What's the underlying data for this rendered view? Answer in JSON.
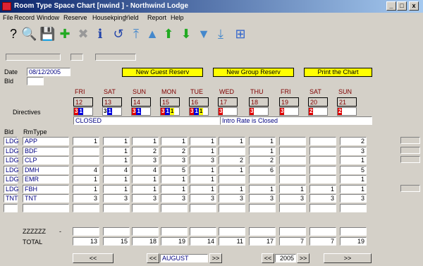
{
  "window": {
    "title": "Room Type Space Chart [nwind  ] - Northwind Lodge",
    "min": "_",
    "max": "□",
    "close": "x"
  },
  "menu": [
    "File",
    "Record",
    "Window",
    "Reserve",
    "Housekping",
    "Yield",
    "Report",
    "Help"
  ],
  "toolbar": [
    {
      "name": "help-icon",
      "glyph": "?",
      "color": "#000"
    },
    {
      "name": "search-icon",
      "glyph": "🔍",
      "color": "#666"
    },
    {
      "name": "save-icon",
      "glyph": "💾",
      "color": "#0a4"
    },
    {
      "name": "add-icon",
      "glyph": "✚",
      "color": "#2a2"
    },
    {
      "name": "delete-icon",
      "glyph": "✖",
      "color": "#999"
    },
    {
      "name": "info-icon",
      "glyph": "ℹ",
      "color": "#24a"
    },
    {
      "name": "undo-icon",
      "glyph": "↺",
      "color": "#24a"
    },
    {
      "name": "first-record-icon",
      "glyph": "⤒",
      "color": "#48c"
    },
    {
      "name": "prev-record-icon",
      "glyph": "▲",
      "color": "#48c"
    },
    {
      "name": "up-icon",
      "glyph": "⬆",
      "color": "#2a2"
    },
    {
      "name": "down-icon",
      "glyph": "⬇",
      "color": "#2a2"
    },
    {
      "name": "next-record-icon",
      "glyph": "▼",
      "color": "#48c"
    },
    {
      "name": "last-record-icon",
      "glyph": "⤓",
      "color": "#48c"
    },
    {
      "name": "windows-icon",
      "glyph": "⊞",
      "color": "#36c"
    }
  ],
  "form": {
    "date_label": "Date",
    "date_value": "08/12/2005",
    "bld_label": "Bld",
    "bld_value": ""
  },
  "buttons": {
    "new_guest": "New Guest Reserv",
    "new_group": "New Group Reserv",
    "print": "Print the Chart"
  },
  "days": [
    {
      "dow": "FRI",
      "day": "12",
      "dir": [
        "3",
        "1"
      ],
      "dc": [
        "#e00000",
        "#0000e0"
      ]
    },
    {
      "dow": "SAT",
      "day": "13",
      "dir": [
        "3",
        "1"
      ],
      "dc": [
        "#ffffff",
        "#0000e0"
      ]
    },
    {
      "dow": "SUN",
      "day": "14",
      "dir": [
        "3",
        "1"
      ],
      "dc": [
        "#e00000",
        "#0000e0"
      ]
    },
    {
      "dow": "MON",
      "day": "15",
      "dir": [
        "3",
        "1",
        "1"
      ],
      "dc": [
        "#e00000",
        "#0000e0",
        "#ffff00"
      ]
    },
    {
      "dow": "TUE",
      "day": "16",
      "dir": [
        "3",
        "1",
        "1"
      ],
      "dc": [
        "#e00000",
        "#0000e0",
        "#ffff00"
      ]
    },
    {
      "dow": "WED",
      "day": "17",
      "dir": [
        "3"
      ],
      "dc": [
        "#e00000"
      ]
    },
    {
      "dow": "THU",
      "day": "18",
      "dir": [
        "3"
      ],
      "dc": [
        "#e00000"
      ]
    },
    {
      "dow": "FRI",
      "day": "19",
      "dir": [
        "3"
      ],
      "dc": [
        "#e00000"
      ]
    },
    {
      "dow": "SAT",
      "day": "20",
      "dir": [
        "2"
      ],
      "dc": [
        "#e00000"
      ]
    },
    {
      "dow": "SUN",
      "day": "21",
      "dir": [
        "2"
      ],
      "dc": [
        "#e00000"
      ]
    }
  ],
  "directives_label": "Directives",
  "notes": {
    "closed": "CLOSED",
    "intro": "Intro Rate is Closed"
  },
  "col_bld": "Bld",
  "col_rmtype": "RmType",
  "rows": [
    {
      "bld": "LDG",
      "rm": "APP",
      "v": [
        "1",
        "1",
        "1",
        "1",
        "1",
        "1",
        "1",
        "",
        "",
        "2"
      ]
    },
    {
      "bld": "LDG",
      "rm": "BDF",
      "v": [
        "",
        "1",
        "2",
        "2",
        "1",
        "",
        "1",
        "",
        "",
        "3"
      ]
    },
    {
      "bld": "LDG",
      "rm": "CLP",
      "v": [
        "",
        "1",
        "3",
        "3",
        "3",
        "2",
        "2",
        "",
        "",
        "1"
      ]
    },
    {
      "bld": "LDG",
      "rm": "DMH",
      "v": [
        "4",
        "4",
        "4",
        "5",
        "1",
        "1",
        "6",
        "",
        "",
        "5"
      ]
    },
    {
      "bld": "LDG",
      "rm": "EMR",
      "v": [
        "1",
        "1",
        "1",
        "1",
        "1",
        "",
        "",
        "",
        "",
        "1"
      ]
    },
    {
      "bld": "LDG",
      "rm": "FBH",
      "v": [
        "1",
        "1",
        "1",
        "1",
        "1",
        "1",
        "1",
        "1",
        "1",
        "1"
      ]
    },
    {
      "bld": "TNT",
      "rm": "TNT",
      "v": [
        "3",
        "3",
        "3",
        "3",
        "3",
        "3",
        "3",
        "3",
        "3",
        "3"
      ]
    },
    {
      "bld": "",
      "rm": "",
      "v": [
        "",
        "",
        "",
        "",
        "",
        "",
        "",
        "",
        "",
        ""
      ]
    }
  ],
  "zzz_label": "ZZZZZZ",
  "zzz_dash": "-",
  "total_label": "TOTAL",
  "totals": [
    "13",
    "15",
    "18",
    "19",
    "14",
    "11",
    "17",
    "7",
    "7",
    "19"
  ],
  "nav": {
    "prev": "<<",
    "month_prev": "<<",
    "month": "AUGUST",
    "month_next": ">>",
    "year_prev": "<<",
    "year": "2005",
    "year_next": ">>",
    "next": ">>"
  }
}
